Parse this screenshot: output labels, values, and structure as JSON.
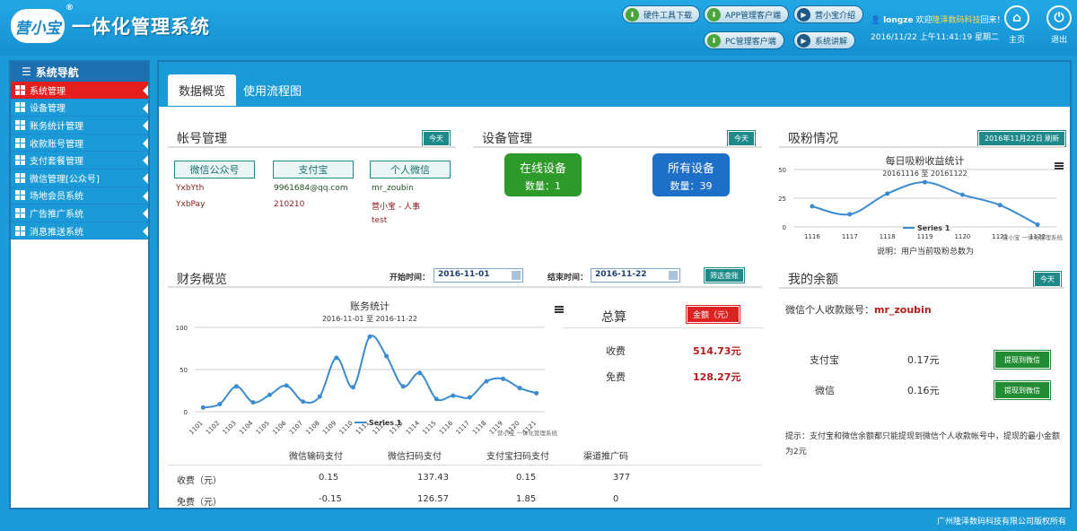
{
  "header": {
    "logo_text": "营小宝",
    "logo_mark": "®",
    "title": "一体化管理系统",
    "buttons": [
      {
        "label": "硬件工具下载",
        "icon": "download-icon"
      },
      {
        "label": "APP管理客户端",
        "icon": "download-icon"
      },
      {
        "label": "营小宝介绍",
        "icon": "play-icon"
      },
      {
        "label": "PC管理客户端",
        "icon": "download-icon"
      },
      {
        "label": "系统讲解",
        "icon": "play-icon"
      }
    ],
    "user": {
      "name": "longze",
      "welcome_pre": " 欢迎",
      "company": "隆泽数码科技",
      "welcome_post": "回来！",
      "datetime": "2016/11/22 上午11:41:19 星期二"
    },
    "home_label": "主页",
    "logout_label": "退出"
  },
  "sidebar": {
    "title": "系统导航",
    "items": [
      "系统管理",
      "设备管理",
      "账务统计管理",
      "收款账号管理",
      "支付套餐管理",
      "微信管理[公众号]",
      "场地会员系统",
      "广告推广系统",
      "消息推送系统"
    ]
  },
  "tabs": [
    "数据概览",
    "使用流程图"
  ],
  "account_panel": {
    "title": "帐号管理",
    "badge": "今天",
    "columns": [
      {
        "label": "微信公众号",
        "values": [
          "YxbYth",
          "YxbPay"
        ]
      },
      {
        "label": "支付宝",
        "values": [
          "9961684@qq.com",
          "210210"
        ]
      },
      {
        "label": "个人微信",
        "values": [
          "mr_zoubin",
          "营小宝 - 人事",
          "test"
        ]
      }
    ]
  },
  "device_panel": {
    "title": "设备管理",
    "badge": "今天",
    "online": {
      "label": "在线设备",
      "count": "数量：1"
    },
    "all": {
      "label": "所有设备",
      "count": "数量：39"
    }
  },
  "fans_panel": {
    "title": "吸粉情况",
    "badge": "2016年11月22日 刷新",
    "note": "说明：用户当前吸粉总数为"
  },
  "finance_panel": {
    "title": "财务概览",
    "start_label": "开始时间：",
    "start_value": "2016-11-01",
    "end_label": "结束时间：",
    "end_value": "2016-11-22",
    "filter_button": "筛选查账",
    "total_title": "总算",
    "total_badge": "金额（元）",
    "total_rows": [
      {
        "label": "收费",
        "value": "514.73元"
      },
      {
        "label": "免费",
        "value": "128.27元"
      }
    ],
    "table": {
      "headers": [
        "",
        "微信输码支付",
        "微信扫码支付",
        "支付宝扫码支付",
        "渠道推广码"
      ],
      "rows": [
        [
          "收费（元）",
          "0.15",
          "137.43",
          "0.15",
          "377"
        ],
        [
          "免费（元）",
          "-0.15",
          "126.57",
          "1.85",
          "0"
        ]
      ]
    }
  },
  "balance_panel": {
    "title": "我的余额",
    "badge": "今天",
    "account_label": "微信个人收款账号：",
    "account_value": "mr_zoubin",
    "rows": [
      {
        "label": "支付宝",
        "value": "0.17元",
        "button": "提现到微信"
      },
      {
        "label": "微信",
        "value": "0.16元",
        "button": "提现到微信"
      }
    ],
    "hint": "提示：支付宝和微信余额都只能提现到微信个人收款帐号中，提现的最小金额为2元"
  },
  "chart_data": [
    {
      "type": "line",
      "title": "每日吸粉收益统计",
      "subtitle": "20161116 至 20161122",
      "categories": [
        "1116",
        "1117",
        "1118",
        "1119",
        "1120",
        "1121",
        "1122"
      ],
      "series": [
        {
          "name": "Series 1",
          "values": [
            18,
            11,
            29,
            39,
            28,
            19,
            2
          ]
        }
      ],
      "ylim": [
        0,
        50
      ],
      "yticks": [
        0,
        25,
        50
      ],
      "credit": "营小宝 一体化管理系统",
      "color": "#3b8bd1"
    },
    {
      "type": "line",
      "title": "账务统计",
      "subtitle": "2016-11-01 至 2016-11-22",
      "categories": [
        "1101",
        "1102",
        "1103",
        "1104",
        "1105",
        "1106",
        "1107",
        "1108",
        "1109",
        "1110",
        "1111",
        "1112",
        "1113",
        "1114",
        "1115",
        "1116",
        "1117",
        "1118",
        "1119",
        "1120",
        "1121"
      ],
      "series": [
        {
          "name": "Series 1",
          "values": [
            5,
            9,
            30,
            11,
            20,
            31,
            12,
            18,
            64,
            29,
            89,
            66,
            30,
            46,
            15,
            19,
            17,
            36,
            39,
            28,
            22
          ]
        }
      ],
      "ylim": [
        0,
        100
      ],
      "yticks": [
        0,
        50,
        100
      ],
      "credit": "营小宝 一体化管理系统",
      "color": "#3b8bd1"
    }
  ]
}
